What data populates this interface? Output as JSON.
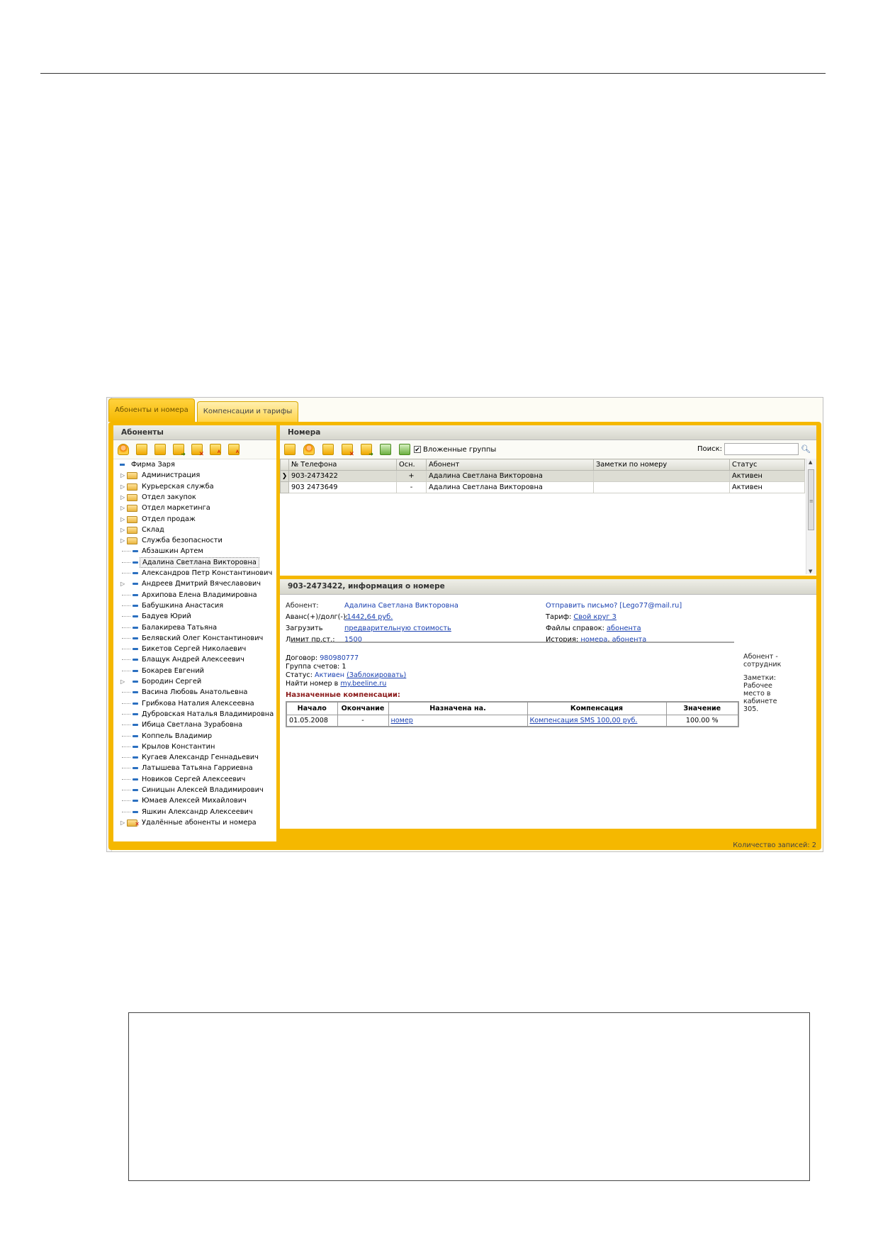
{
  "tabs": [
    {
      "label": "Абоненты и номера",
      "active": true
    },
    {
      "label": "Компенсации и тарифы",
      "active": false
    }
  ],
  "left_panel": {
    "title": "Абоненты",
    "toolbar_icons": [
      "add-subscriber-icon",
      "add-group-icon",
      "edit-icon",
      "move-icon",
      "delete-icon",
      "sort-az-icon",
      "sort-za-icon"
    ],
    "tree": {
      "root": "Фирма Заря",
      "folders": [
        "Администрация",
        "Курьерская служба",
        "Отдел закупок",
        "Отдел маркетинга",
        "Отдел продаж",
        "Склад",
        "Служба безопасности"
      ],
      "subscribers": [
        {
          "name": "Абзашкин Артем",
          "expandable": false
        },
        {
          "name": "Адалина Светлана Викторовна",
          "expandable": false,
          "selected": true
        },
        {
          "name": "Александров Петр Константинович",
          "expandable": false
        },
        {
          "name": "Андреев Дмитрий Вячеславович",
          "expandable": true
        },
        {
          "name": "Архипова Елена Владимировна",
          "expandable": false
        },
        {
          "name": "Бабушкина Анастасия",
          "expandable": false
        },
        {
          "name": "Бадуев Юрий",
          "expandable": false
        },
        {
          "name": "Балакирева Татьяна",
          "expandable": false
        },
        {
          "name": "Белявский Олег Константинович",
          "expandable": false
        },
        {
          "name": "Бикетов Сергей Николаевич",
          "expandable": false
        },
        {
          "name": "Блащук Андрей Алексеевич",
          "expandable": false
        },
        {
          "name": "Бокарев Евгений",
          "expandable": false
        },
        {
          "name": "Бородин Сергей",
          "expandable": true
        },
        {
          "name": "Васина Любовь Анатольевна",
          "expandable": false
        },
        {
          "name": "Грибкова Наталия Алексеевна",
          "expandable": false
        },
        {
          "name": "Дубровская Наталья Владимировна",
          "expandable": false
        },
        {
          "name": "Ибица Светлана Зурабовна",
          "expandable": false
        },
        {
          "name": "Коппель Владимир",
          "expandable": false
        },
        {
          "name": "Крылов Константин",
          "expandable": false
        },
        {
          "name": "Кугаев Александр Геннадьевич",
          "expandable": false
        },
        {
          "name": "Латышева Татьяна Гарриевна",
          "expandable": false
        },
        {
          "name": "Новиков Сергей Алексеевич",
          "expandable": false
        },
        {
          "name": "Синицын Алексей Владимирович",
          "expandable": false
        },
        {
          "name": "Юмаев Алексей Михайлович",
          "expandable": false
        },
        {
          "name": "Яшкин Александр Алексеевич",
          "expandable": false
        }
      ],
      "deleted_folder": "Удалённые абоненты и номера"
    }
  },
  "numbers_panel": {
    "title": "Номера",
    "toolbar_icons": [
      "add-number-icon",
      "assign-subscriber-icon",
      "edit-number-icon",
      "delete-number-icon",
      "move-number-icon",
      "export-icon",
      "refresh-icon"
    ],
    "nested_groups_label": "Вложенные группы",
    "nested_groups_checked": true,
    "search_label": "Поиск:",
    "search_value": "",
    "columns": [
      "№ Телефона",
      "Осн.",
      "Абонент",
      "Заметки по номеру",
      "Статус"
    ],
    "rows": [
      {
        "phone": "903-2473422",
        "main": "+",
        "subscriber": "Адалина Светлана Викторовна",
        "notes": "",
        "status": "Активен",
        "selected": true
      },
      {
        "phone": "903 2473649",
        "main": "-",
        "subscriber": "Адалина Светлана Викторовна",
        "notes": "",
        "status": "Активен",
        "selected": false
      }
    ]
  },
  "info_panel": {
    "title": "903-2473422, информация о номере",
    "subscriber_label": "Абонент:",
    "subscriber_value": "Адалина Светлана Викторовна",
    "balance_label": "Аванс(+)/долг(-):",
    "balance_value": "-1442,64 руб.",
    "load_label": "Загрузить",
    "load_value": "предварительную стоимость",
    "limit_label": "Лимит пр.ст.:",
    "limit_value": "1500",
    "send_mail_value": "Отправить письмо? [Lego77@mail.ru]",
    "tariff_label": "Тариф:",
    "tariff_value": "Свой круг 3",
    "files_label": "Файлы справок:",
    "files_value": "абонента",
    "history_label": "История:",
    "history_number": "номера",
    "history_sep": ",",
    "history_subscriber": "абонента",
    "contract_label": "Договор:",
    "contract_value": "980980777",
    "accounts_line": "Группа счетов: 1",
    "status_label": "Статус:",
    "status_value": "Активен",
    "block_link": "(Заблокировать)",
    "find_label": "Найти номер в",
    "find_link": "my.beeline.ru",
    "compensations_title": "Назначенные компенсации:",
    "comp_columns": [
      "Начало",
      "Окончание",
      "Назначена на.",
      "Компенсация",
      "Значение"
    ],
    "comp_rows": [
      {
        "start": "01.05.2008",
        "end": "-",
        "assigned_to": "номер",
        "compensation": "Компенсация SMS 100,00 руб.",
        "value": "100.00 %"
      }
    ],
    "side_note_1_line1": "Абонент -",
    "side_note_1_line2": "сотрудник",
    "side_note_2_lines": [
      "Заметки:",
      "Рабочее",
      "место в",
      "кабинете",
      "305."
    ]
  },
  "status_bar": "Количество записей: 2"
}
